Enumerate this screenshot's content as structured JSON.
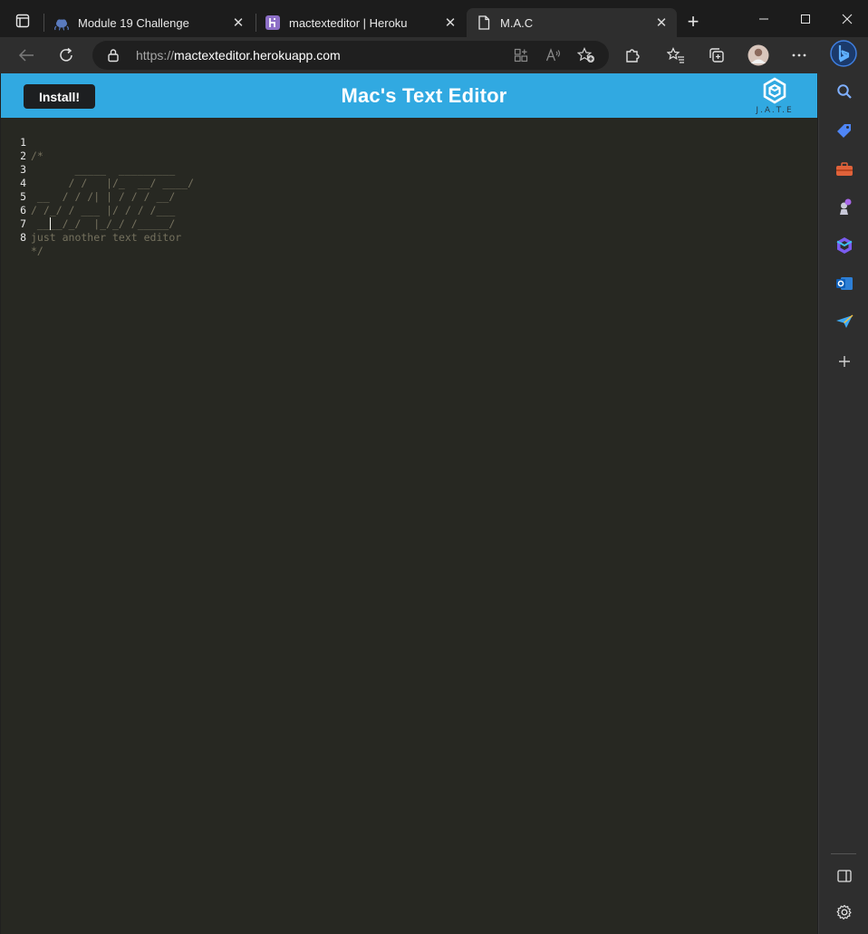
{
  "browser": {
    "tabs": [
      {
        "title": "Module 19 Challenge",
        "icon": "github-octocat-icon",
        "active": false
      },
      {
        "title": "mactexteditor | Heroku",
        "icon": "heroku-icon",
        "active": false
      },
      {
        "title": "M.A.C",
        "icon": "document-icon",
        "active": true
      }
    ],
    "address": {
      "scheme": "https://",
      "host": "mactexteditor.herokuapp.com"
    }
  },
  "app": {
    "install_label": "Install!",
    "title": "Mac's Text Editor",
    "logo_text": "J.A.T.E",
    "header_color": "#31a9e1"
  },
  "editor": {
    "background": "#272822",
    "comment_color": "#75715e",
    "lines": [
      {
        "number": "1",
        "text": "/*"
      },
      {
        "number": "2",
        "text": "       _____  _________"
      },
      {
        "number": "3",
        "text": "      / /   |/_  __/ ____/"
      },
      {
        "number": "4",
        "text": " __  / / /| | / / / __/"
      },
      {
        "number": "5",
        "text": "/ /_/ / ___ |/ / / /___"
      },
      {
        "number": "6",
        "text": " ____/_/  |_/_/ /_____/"
      },
      {
        "number": "7",
        "text": "just another text editor"
      },
      {
        "number": "8",
        "text": "*/"
      }
    ]
  }
}
